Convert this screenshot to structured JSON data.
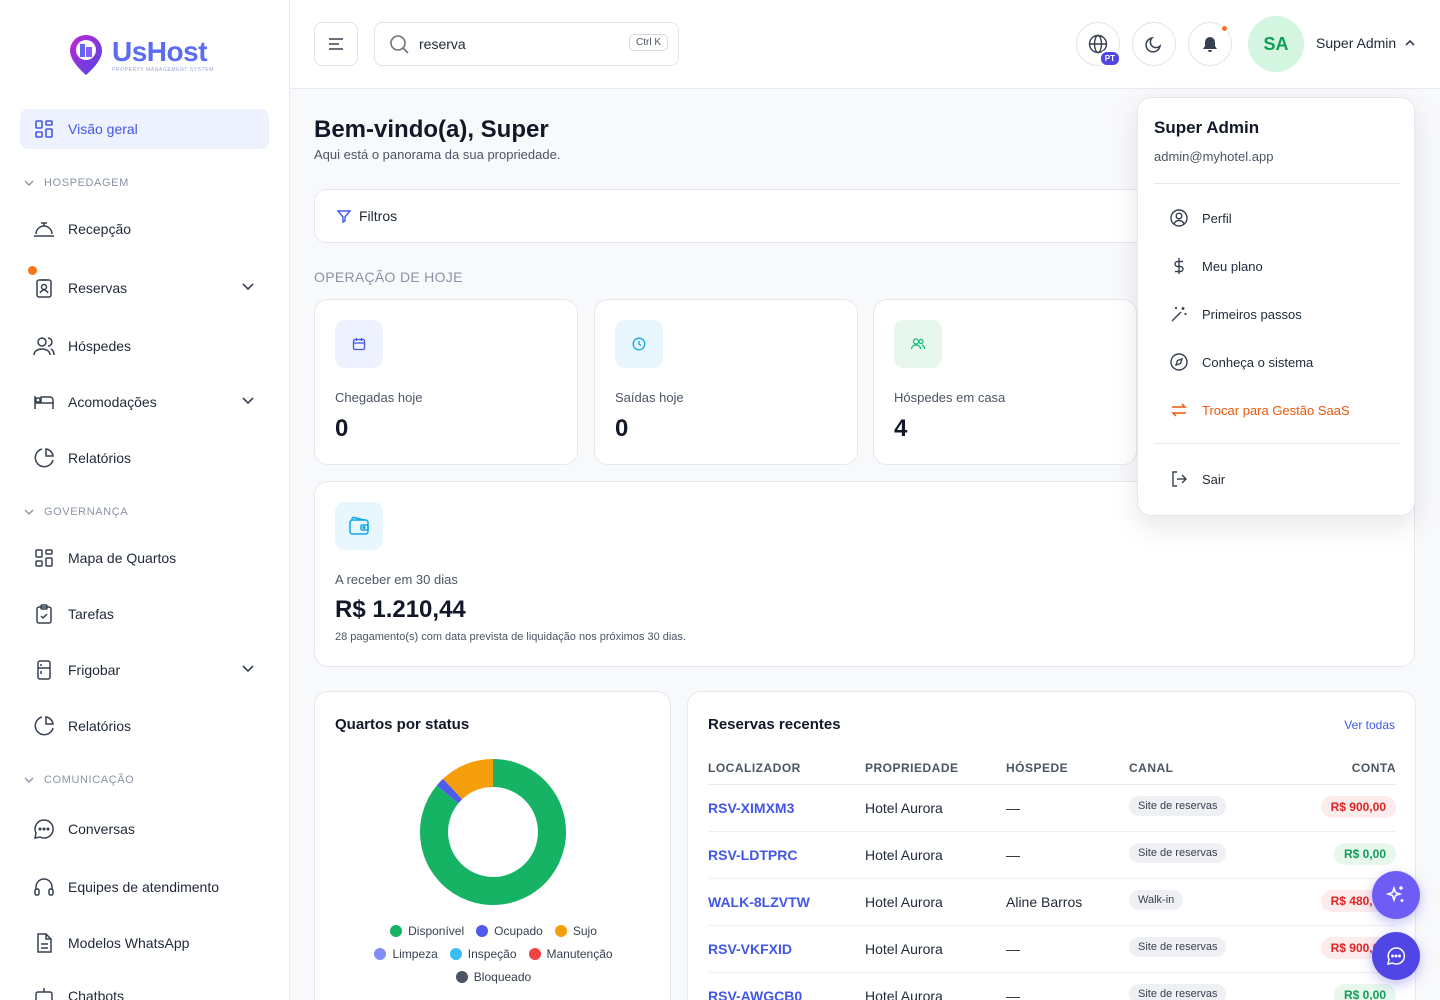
{
  "app": {
    "name": "UsHost",
    "tagline": "PROPERTY MANAGEMENT SYSTEM"
  },
  "sidebar": {
    "overview": "Visão geral",
    "sections": {
      "lodging": "HOSPEDAGEM",
      "housekeeping": "GOVERNANÇA",
      "communication": "COMUNICAÇÃO"
    },
    "items": {
      "reception": "Recepção",
      "reservations": "Reservas",
      "guests": "Hóspedes",
      "accommodations": "Acomodações",
      "reports": "Relatórios",
      "room_map": "Mapa de Quartos",
      "tasks": "Tarefas",
      "minibar": "Frigobar",
      "reports2": "Relatórios",
      "conversations": "Conversas",
      "support_teams": "Equipes de atendimento",
      "whatsapp_templates": "Modelos WhatsApp",
      "chatbots": "Chatbots"
    }
  },
  "header": {
    "search_value": "reserva",
    "shortcut": "Ctrl K",
    "language_badge": "PT",
    "avatar_initials": "SA",
    "user_name": "Super Admin"
  },
  "main": {
    "title": "Bem-vindo(a), Super",
    "subtitle": "Aqui está o panorama da sua propriedade.",
    "filters_label": "Filtros",
    "operations_label": "OPERAÇÃO DE HOJE",
    "stats": [
      {
        "label": "Chegadas hoje",
        "value": "0",
        "color": "#4257e6",
        "bg": "#eef1fe"
      },
      {
        "label": "Saídas hoje",
        "value": "0",
        "color": "#0ea5e9",
        "bg": "#e8f6fd"
      },
      {
        "label": "Hóspedes em casa",
        "value": "4",
        "color": "#10b981",
        "bg": "#e7f7ee"
      }
    ],
    "receivable": {
      "label": "A receber em 30 dias",
      "value": "R$ 1.210,44",
      "note": "28 pagamento(s) com data prevista de liquidação nos próximos 30 dias."
    }
  },
  "rooms_chart": {
    "title": "Quartos por status",
    "legend": [
      {
        "name": "Disponível",
        "color": "#16b364"
      },
      {
        "name": "Ocupado",
        "color": "#4f5bea"
      },
      {
        "name": "Sujo",
        "color": "#f59e0b"
      },
      {
        "name": "Limpeza",
        "color": "#818cf8"
      },
      {
        "name": "Inspeção",
        "color": "#38bdf8"
      },
      {
        "name": "Manutenção",
        "color": "#ef4444"
      },
      {
        "name": "Bloqueado",
        "color": "#4b5563"
      }
    ]
  },
  "chart_data": {
    "type": "pie",
    "title": "Quartos por status",
    "categories": [
      "Disponível",
      "Ocupado",
      "Sujo",
      "Limpeza",
      "Inspeção",
      "Manutenção",
      "Bloqueado"
    ],
    "values": [
      86,
      2,
      12,
      0,
      0,
      0,
      0
    ],
    "colors": [
      "#16b364",
      "#4f5bea",
      "#f59e0b",
      "#818cf8",
      "#38bdf8",
      "#ef4444",
      "#4b5563"
    ],
    "legend": "bottom"
  },
  "reservations": {
    "title": "Reservas recentes",
    "see_all": "Ver todas",
    "columns": [
      "LOCALIZADOR",
      "PROPRIEDADE",
      "HÓSPEDE",
      "CANAL",
      "CONTA"
    ],
    "rows": [
      {
        "code": "RSV-XIMXM3",
        "property": "Hotel Aurora",
        "guest": "—",
        "channel": "Site de reservas",
        "amount": "R$ 900,00",
        "status": "neg"
      },
      {
        "code": "RSV-LDTPRC",
        "property": "Hotel Aurora",
        "guest": "—",
        "channel": "Site de reservas",
        "amount": "R$ 0,00",
        "status": "pos"
      },
      {
        "code": "WALK-8LZVTW",
        "property": "Hotel Aurora",
        "guest": "Aline Barros",
        "channel": "Walk-in",
        "amount": "R$ 480,00",
        "status": "neg"
      },
      {
        "code": "RSV-VKFXID",
        "property": "Hotel Aurora",
        "guest": "—",
        "channel": "Site de reservas",
        "amount": "R$ 900,00",
        "status": "neg"
      },
      {
        "code": "RSV-AWGCB0",
        "property": "Hotel Aurora",
        "guest": "—",
        "channel": "Site de reservas",
        "amount": "R$ 0,00",
        "status": "pos"
      }
    ]
  },
  "dropdown": {
    "name": "Super Admin",
    "email": "admin@myhotel.app",
    "items": {
      "profile": "Perfil",
      "plan": "Meu plano",
      "getting_started": "Primeiros passos",
      "tour": "Conheça o sistema",
      "switch_saas": "Trocar para Gestão SaaS",
      "logout": "Sair"
    }
  }
}
